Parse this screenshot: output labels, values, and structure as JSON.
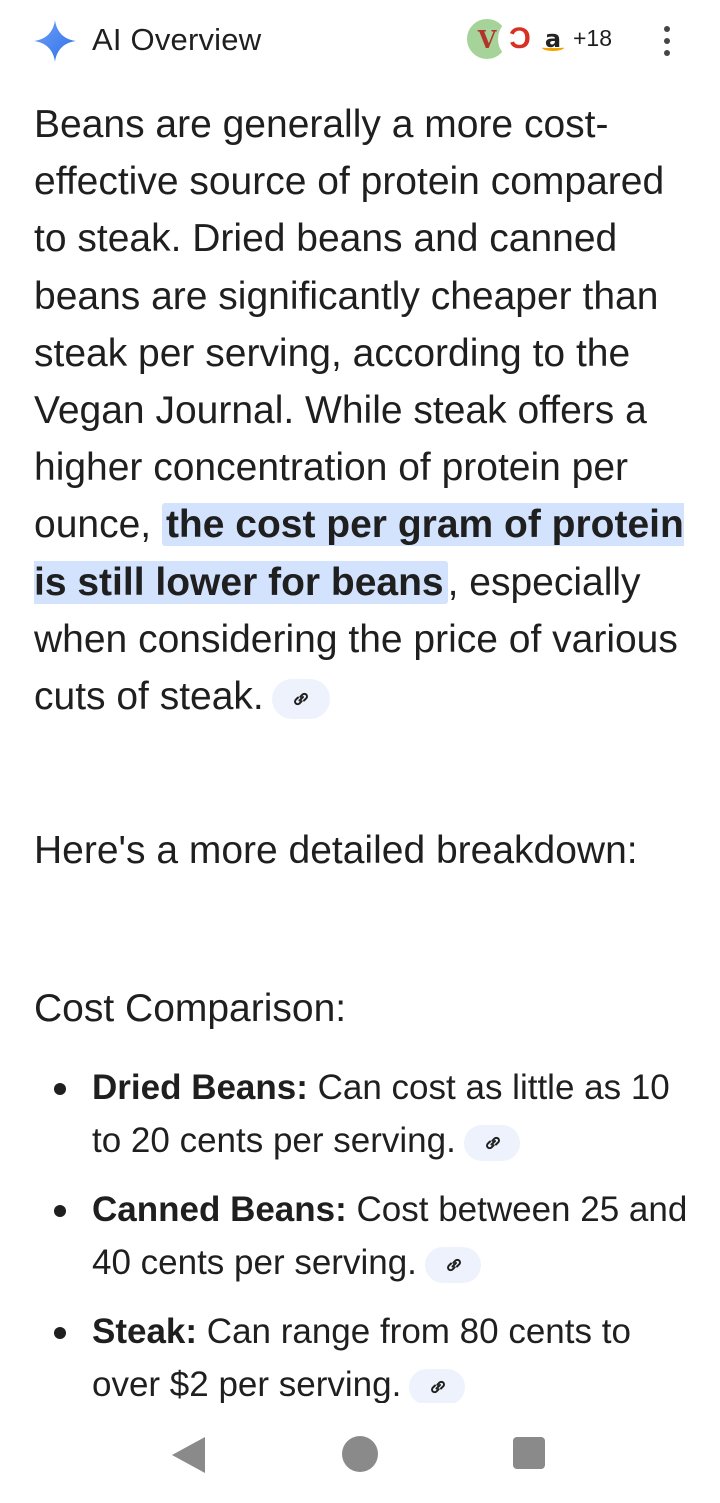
{
  "header": {
    "title": "AI Overview",
    "more_sources_count": "+18",
    "sources": [
      {
        "name": "source-1",
        "glyph": "V"
      },
      {
        "name": "source-2",
        "glyph": "Ɔ"
      },
      {
        "name": "source-3",
        "glyph": "a"
      }
    ],
    "spark_colors": [
      "#4285f4",
      "#6ea0f7"
    ]
  },
  "overview": {
    "text_before": "Beans are generally a more cost-effective source of protein compared to steak. Dried beans and canned beans are significantly cheaper than steak per serving, according to the Vegan Journal. While steak offers a higher concentration of protein per ounce, ",
    "highlight": "the cost per gram of protein is still lower for beans",
    "text_after": ", especially when considering the price of various cuts of steak."
  },
  "breakdown_intro": "Here's a more detailed breakdown:",
  "section_title": "Cost Comparison:",
  "items": [
    {
      "label": "Dried Beans:",
      "text": " Can cost as little as 10 to 20 cents per serving."
    },
    {
      "label": "Canned Beans:",
      "text": " Cost between 25 and 40 cents per serving."
    },
    {
      "label": "Steak:",
      "text": " Can range from 80 cents to over $2 per serving."
    }
  ],
  "icons": {
    "link": "link-icon",
    "more": "more-vert-icon",
    "spark": "ai-sparkle-icon"
  },
  "colors": {
    "highlight_bg": "#d3e3fd",
    "chip_bg": "#edf2fc",
    "text": "#1f1f1f",
    "nav_gray": "#8a8a8a"
  }
}
